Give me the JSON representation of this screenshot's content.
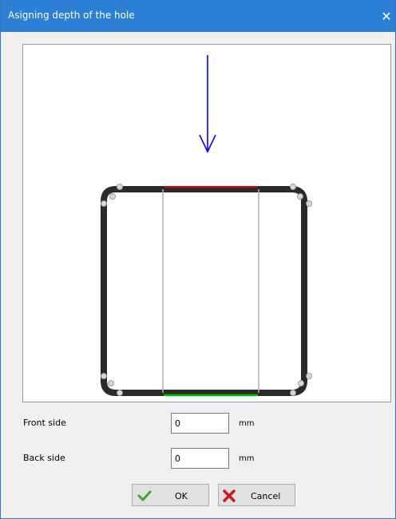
{
  "window": {
    "title": "Asigning depth of the hole",
    "close_glyph": "✕",
    "title_bar_color": "#2b7fd4"
  },
  "preview": {
    "arrow_color": "#0000ff",
    "front_edge_color": "#e00000",
    "back_edge_color": "#00c000",
    "frame_color": "#2a2a2a",
    "hole_line_color": "#b0b0b0",
    "arrow_icon": "down-arrow-icon"
  },
  "form": {
    "front_label": "Front side",
    "front_value": "0",
    "front_unit": "mm",
    "back_label": "Back side",
    "back_value": "0",
    "back_unit": "mm"
  },
  "buttons": {
    "ok_label": "OK",
    "ok_icon": "green-check-icon",
    "cancel_label": "Cancel",
    "cancel_icon": "red-x-icon"
  }
}
